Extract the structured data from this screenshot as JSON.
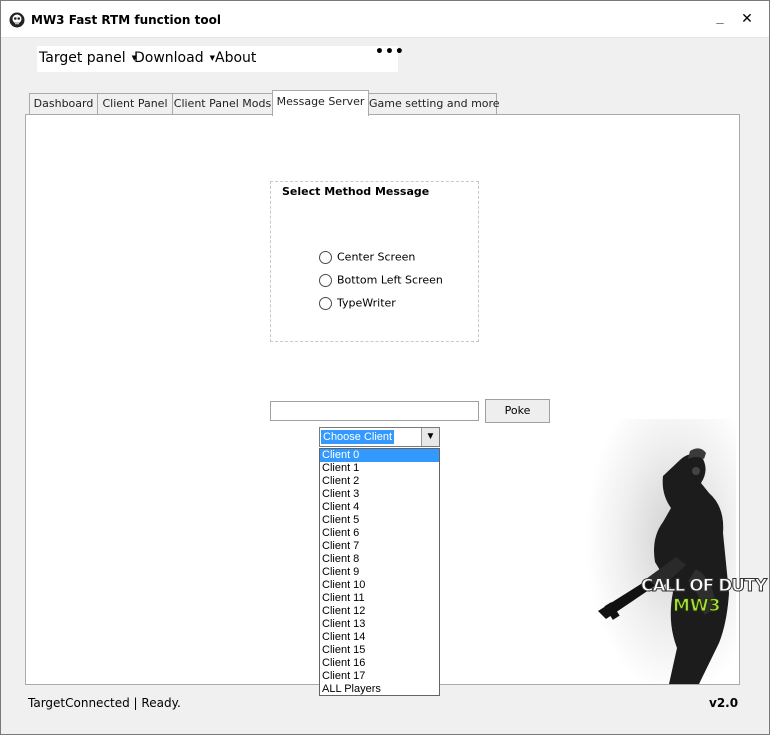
{
  "window": {
    "title": "MW3 Fast RTM function tool",
    "minimize_glyph": "_",
    "close_glyph": "✕"
  },
  "menu": {
    "items": [
      {
        "label": "Target panel",
        "has_dropdown": true
      },
      {
        "label": "Download",
        "has_dropdown": true
      },
      {
        "label": "About",
        "has_dropdown": false
      }
    ],
    "more_label": "•••"
  },
  "tabs": [
    {
      "label": "Dashboard",
      "active": false
    },
    {
      "label": "Client Panel",
      "active": false
    },
    {
      "label": "Client Panel Mods",
      "active": false
    },
    {
      "label": "Message Server",
      "active": true
    },
    {
      "label": "Game setting and more",
      "active": false
    }
  ],
  "message_server": {
    "group_title": "Select Method Message",
    "options": [
      "Center Screen",
      "Bottom Left Screen",
      "TypeWriter"
    ],
    "message_input_value": "",
    "poke_label": "Poke",
    "client_combo": {
      "selected": "Choose Client",
      "highlighted_option": "Client 0",
      "options": [
        "Client 0",
        "Client 1",
        "Client 2",
        "Client 3",
        "Client 4",
        "Client 5",
        "Client 6",
        "Client 7",
        "Client 8",
        "Client 9",
        "Client 10",
        "Client 11",
        "Client 12",
        "Client 13",
        "Client 14",
        "Client 15",
        "Client 16",
        "Client 17",
        "ALL Players"
      ]
    }
  },
  "artwork": {
    "logo_line1": "CALL OF DUTY",
    "logo_line2": "MW3",
    "accent": "#aadd44"
  },
  "status_bar": {
    "text": "TargetConnected | Ready.",
    "version": "v2.0"
  },
  "colors": {
    "selection": "#3399ff",
    "window_bg": "#f0f0f0"
  }
}
